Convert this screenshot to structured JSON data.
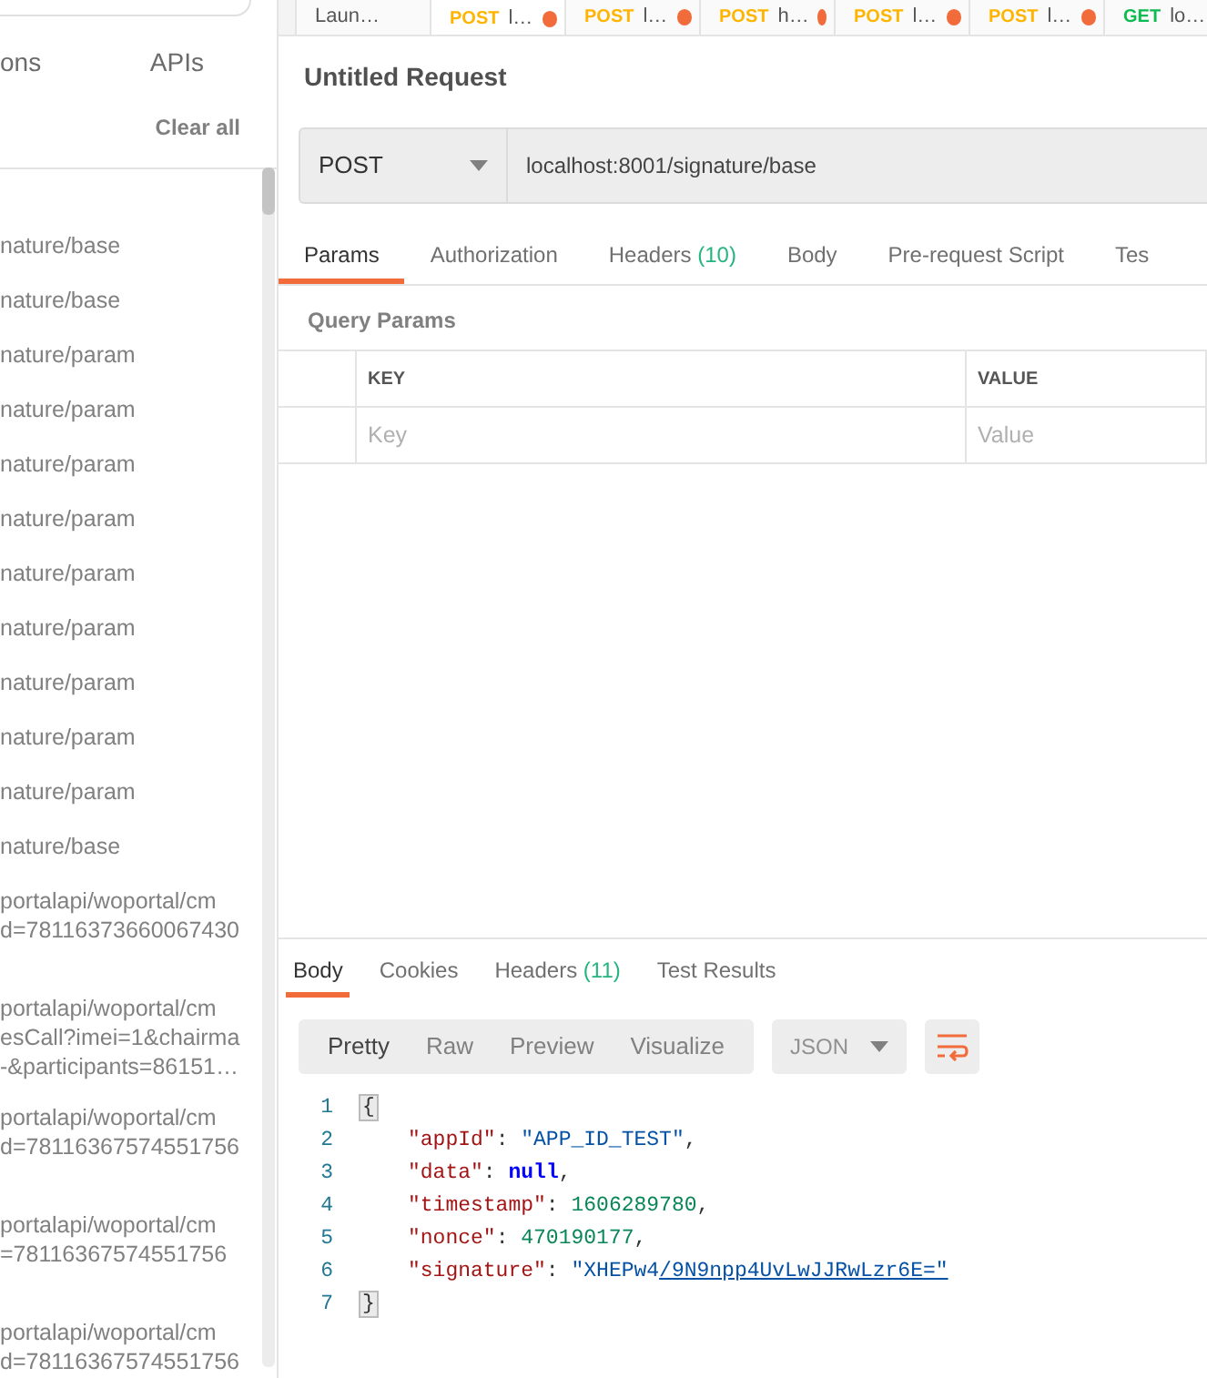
{
  "sidebar": {
    "tabs": [
      {
        "label": "ons",
        "selected": false
      },
      {
        "label": "APIs",
        "selected": false
      }
    ],
    "clear_all": "Clear all",
    "history": [
      {
        "lines": [
          "nature/base"
        ]
      },
      {
        "lines": [
          "nature/base"
        ]
      },
      {
        "lines": [
          "nature/param"
        ]
      },
      {
        "lines": [
          "nature/param"
        ]
      },
      {
        "lines": [
          "nature/param"
        ]
      },
      {
        "lines": [
          "nature/param"
        ]
      },
      {
        "lines": [
          "nature/param"
        ]
      },
      {
        "lines": [
          "nature/param"
        ]
      },
      {
        "lines": [
          "nature/param"
        ]
      },
      {
        "lines": [
          "nature/param"
        ]
      },
      {
        "lines": [
          "nature/param"
        ]
      },
      {
        "lines": [
          "nature/base"
        ]
      },
      {
        "lines": [
          "portalapi/woportal/cm",
          "d=78116373660067430"
        ]
      },
      {
        "lines": [
          "portalapi/woportal/cm",
          "esCall?imei=1&chairma",
          "-&participants=86151…"
        ]
      },
      {
        "lines": [
          "portalapi/woportal/cm",
          "d=78116367574551756"
        ]
      },
      {
        "lines": [
          "portalapi/woportal/cm",
          "=78116367574551756"
        ]
      },
      {
        "lines": [
          "portalapi/woportal/cm",
          "d=78116367574551756"
        ]
      }
    ]
  },
  "request_tabs": [
    {
      "label": "Laun…",
      "selected": false,
      "unsaved": false
    },
    {
      "method": "POST",
      "label": "l…",
      "selected": true,
      "unsaved": true
    },
    {
      "method": "POST",
      "label": "l…",
      "selected": false,
      "unsaved": true
    },
    {
      "method": "POST",
      "label": "h…",
      "selected": false,
      "unsaved": true
    },
    {
      "method": "POST",
      "label": "l…",
      "selected": false,
      "unsaved": true
    },
    {
      "method": "POST",
      "label": "l…",
      "selected": false,
      "unsaved": true
    },
    {
      "method": "GET",
      "label": "lo…",
      "selected": false,
      "unsaved": false
    }
  ],
  "title": "Untitled Request",
  "method": "POST",
  "url": "localhost:8001/signature/base",
  "param_tabs": [
    {
      "label": "Params",
      "selected": true
    },
    {
      "label": "Authorization",
      "selected": false
    },
    {
      "label": "Headers",
      "count": "(10)",
      "selected": false
    },
    {
      "label": "Body",
      "selected": false
    },
    {
      "label": "Pre-request Script",
      "selected": false
    },
    {
      "label": "Tes",
      "selected": false
    }
  ],
  "query_params": {
    "title": "Query Params",
    "columns": [
      "KEY",
      "VALUE"
    ],
    "placeholders": [
      "Key",
      "Value"
    ]
  },
  "response_tabs": [
    {
      "label": "Body",
      "selected": true
    },
    {
      "label": "Cookies",
      "selected": false
    },
    {
      "label": "Headers",
      "count": "(11)",
      "selected": false
    },
    {
      "label": "Test Results",
      "selected": false
    }
  ],
  "view_modes": [
    {
      "label": "Pretty",
      "selected": true
    },
    {
      "label": "Raw",
      "selected": false
    },
    {
      "label": "Preview",
      "selected": false
    },
    {
      "label": "Visualize",
      "selected": false
    }
  ],
  "format": "JSON",
  "code": [
    {
      "number": "1",
      "kind": "brace",
      "tokens": [
        {
          "kind": "punct",
          "text": "{"
        }
      ]
    },
    {
      "number": "2",
      "kind": "member",
      "tokens": [
        {
          "kind": "key",
          "text": "\"appId\""
        },
        {
          "kind": "punct",
          "text": ": "
        },
        {
          "kind": "string",
          "text": "\"APP_ID_TEST\""
        },
        {
          "kind": "punct",
          "text": ","
        }
      ]
    },
    {
      "number": "3",
      "kind": "member",
      "tokens": [
        {
          "kind": "key",
          "text": "\"data\""
        },
        {
          "kind": "punct",
          "text": ": "
        },
        {
          "kind": "null",
          "text": "null"
        },
        {
          "kind": "punct",
          "text": ","
        }
      ]
    },
    {
      "number": "4",
      "kind": "member",
      "tokens": [
        {
          "kind": "key",
          "text": "\"timestamp\""
        },
        {
          "kind": "punct",
          "text": ": "
        },
        {
          "kind": "number",
          "text": "1606289780"
        },
        {
          "kind": "punct",
          "text": ","
        }
      ]
    },
    {
      "number": "5",
      "kind": "member",
      "tokens": [
        {
          "kind": "key",
          "text": "\"nonce\""
        },
        {
          "kind": "punct",
          "text": ": "
        },
        {
          "kind": "number",
          "text": "470190177"
        },
        {
          "kind": "punct",
          "text": ","
        }
      ]
    },
    {
      "number": "6",
      "kind": "member",
      "tokens": [
        {
          "kind": "key",
          "text": "\"signature\""
        },
        {
          "kind": "punct",
          "text": ": "
        },
        {
          "kind": "string",
          "text": "\"XHEPw4"
        },
        {
          "kind": "link",
          "text": "/9N9npp4UvLwJJRwLzr6E=\""
        }
      ]
    },
    {
      "number": "7",
      "kind": "brace",
      "tokens": [
        {
          "kind": "punct",
          "text": "}"
        }
      ]
    }
  ]
}
